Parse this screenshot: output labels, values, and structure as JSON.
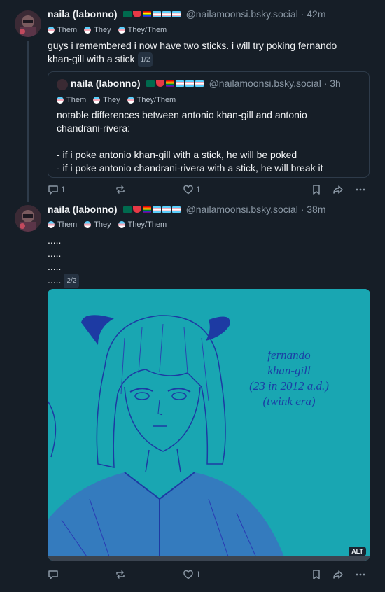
{
  "posts": [
    {
      "author": "naila (labonno)",
      "handle": "@nailamoonsi.bsky.social · 42m",
      "pronouns": [
        "Them",
        "They",
        "They/Them"
      ],
      "text_lines": [
        "guys i remembered i now have two sticks. i will try poking fernando",
        "khan-gill with a stick"
      ],
      "thread_badge": "1/2",
      "quote": {
        "author": "naila (labonno)",
        "handle": "@nailamoonsi.bsky.social · 3h",
        "pronouns": [
          "Them",
          "They",
          "They/Them"
        ],
        "text_lines": [
          "notable differences between antonio khan-gill and antonio",
          "chandrani-rivera:",
          "",
          "- if i poke antonio khan-gill with a stick, he will be poked",
          "- if i poke antonio chandrani-rivera with a stick, he will break it"
        ]
      },
      "actions": {
        "reply_count": "1",
        "repost_count": "",
        "like_count": "1"
      }
    },
    {
      "author": "naila (labonno)",
      "handle": "@nailamoonsi.bsky.social · 38m",
      "pronouns": [
        "Them",
        "They",
        "They/Them"
      ],
      "text_lines": [
        ".....",
        ".....",
        ".....",
        "....."
      ],
      "thread_badge": "2/2",
      "image": {
        "annotation_lines": [
          "fernando",
          "khan-gill",
          "(23 in 2012 a.d.)",
          "(twink era)"
        ],
        "alt_badge": "ALT"
      },
      "actions": {
        "reply_count": "",
        "repost_count": "",
        "like_count": "1"
      }
    }
  ],
  "colors": {
    "background": "#161e27",
    "text": "#f1f3f5",
    "muted": "#8b98a5",
    "border": "#2e3b4a",
    "image_bg": "#19a6b2",
    "ink": "#1a3fa5"
  },
  "icons": [
    "reply-icon",
    "repost-icon",
    "like-icon",
    "bookmark-icon",
    "share-icon",
    "more-icon"
  ]
}
